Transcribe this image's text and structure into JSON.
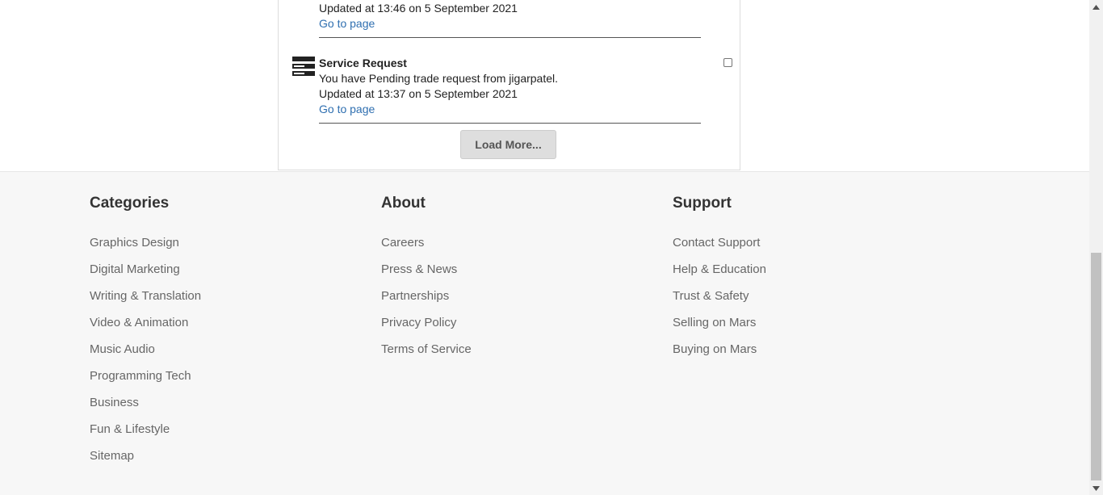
{
  "notifications": [
    {
      "updated": "Updated at 13:46 on 5 September 2021",
      "link": "Go to page"
    },
    {
      "icon": "server-stack-icon",
      "title": "Service Request",
      "message": "You have Pending trade request from jigarpatel.",
      "updated": "Updated at 13:37 on 5 September 2021",
      "link": "Go to page"
    }
  ],
  "load_more_label": "Load More...",
  "footer": {
    "categories": {
      "heading": "Categories",
      "items": [
        "Graphics Design",
        "Digital Marketing",
        "Writing & Translation",
        "Video & Animation",
        "Music Audio",
        "Programming Tech",
        "Business",
        "Fun & Lifestyle",
        "Sitemap"
      ]
    },
    "about": {
      "heading": "About",
      "items": [
        "Careers",
        "Press & News",
        "Partnerships",
        "Privacy Policy",
        "Terms of Service"
      ]
    },
    "support": {
      "heading": "Support",
      "items": [
        "Contact Support",
        "Help & Education",
        "Trust & Safety",
        "Selling on Mars",
        "Buying on Mars"
      ]
    }
  },
  "colors": {
    "link": "#2f6fb0",
    "footer_bg": "#f7f7f7",
    "button_bg": "#dedede"
  }
}
